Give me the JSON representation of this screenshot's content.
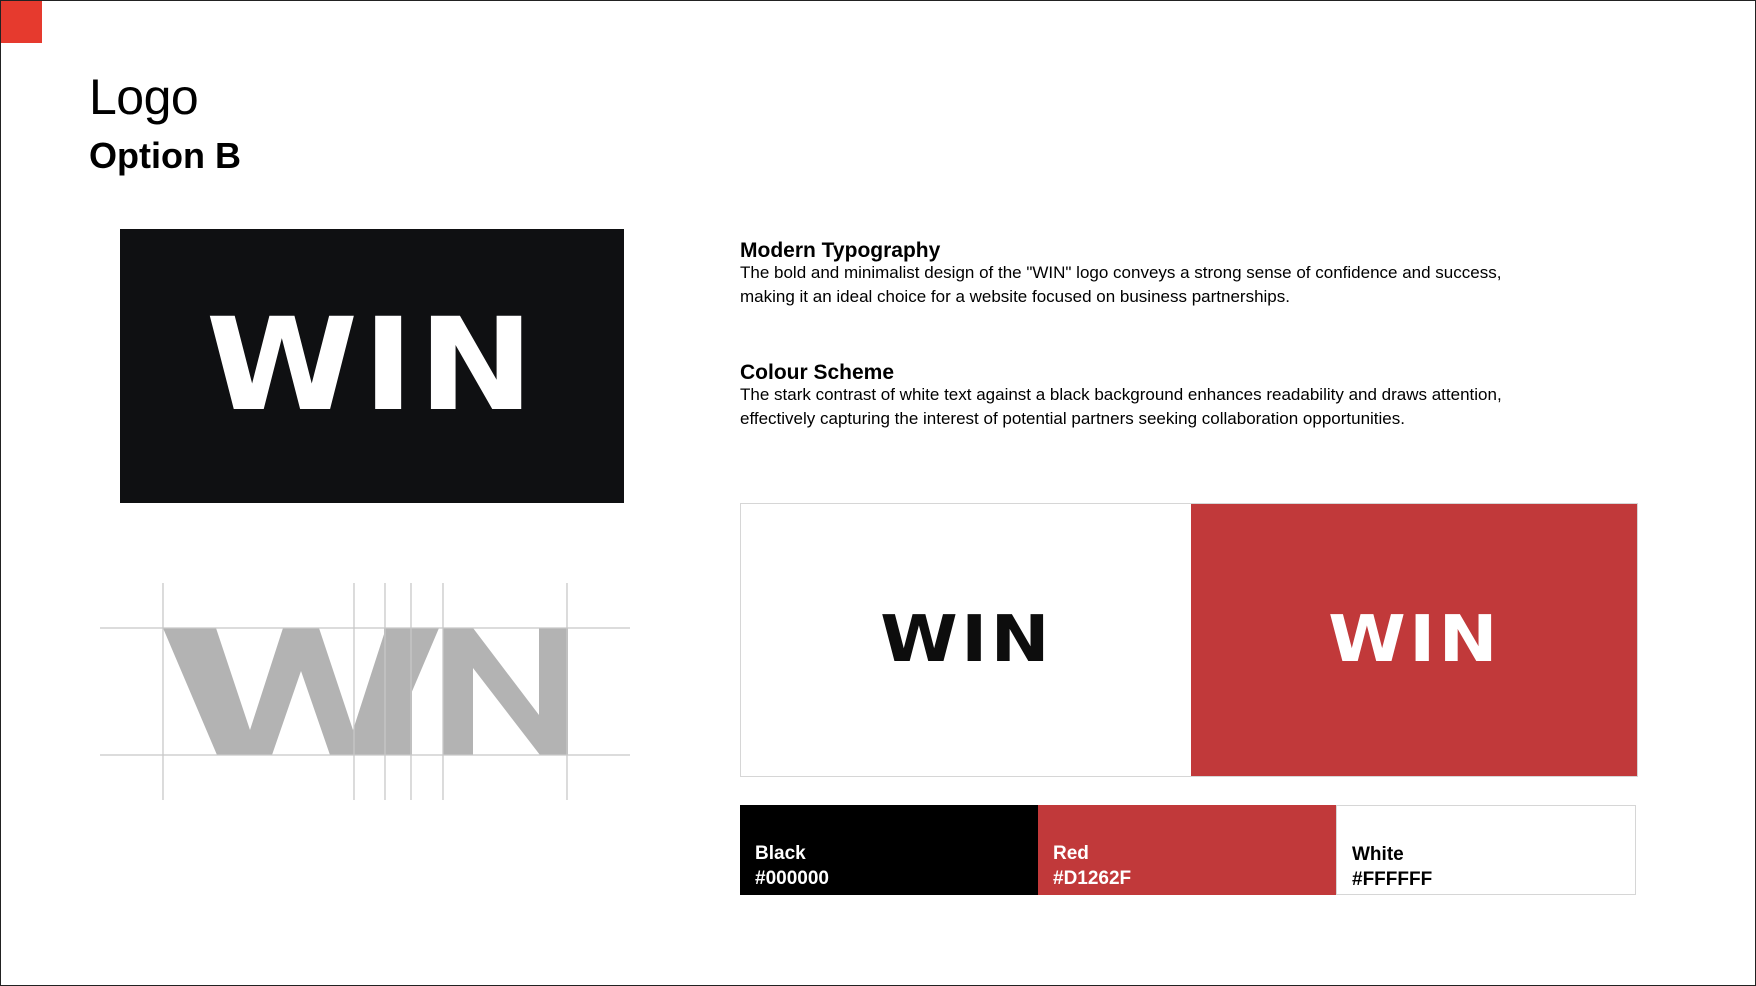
{
  "header": {
    "title": "Logo",
    "subtitle": "Option B"
  },
  "logo": {
    "wordmark": "WIN"
  },
  "sections": [
    {
      "heading": "Modern Typography",
      "lines": [
        "The bold and minimalist design of the \"WIN\" logo conveys a strong sense of confidence and success,",
        "making it an ideal choice for a website focused on business partnerships."
      ]
    },
    {
      "heading": "Colour Scheme",
      "lines": [
        "The stark contrast of white text against a black background enhances readability and draws attention,",
        "effectively capturing the interest of potential partners seeking collaboration opportunities."
      ]
    }
  ],
  "palette": [
    {
      "name": "Black",
      "hex": "#000000"
    },
    {
      "name": "Red",
      "hex": "#D1262F"
    },
    {
      "name": "White",
      "hex": "#FFFFFF"
    }
  ],
  "colors": {
    "accent_corner": "#e63a2e",
    "logo_background": "#0f1012",
    "red_variant": "#c1393a",
    "construction_gray": "#b3b3b3"
  }
}
